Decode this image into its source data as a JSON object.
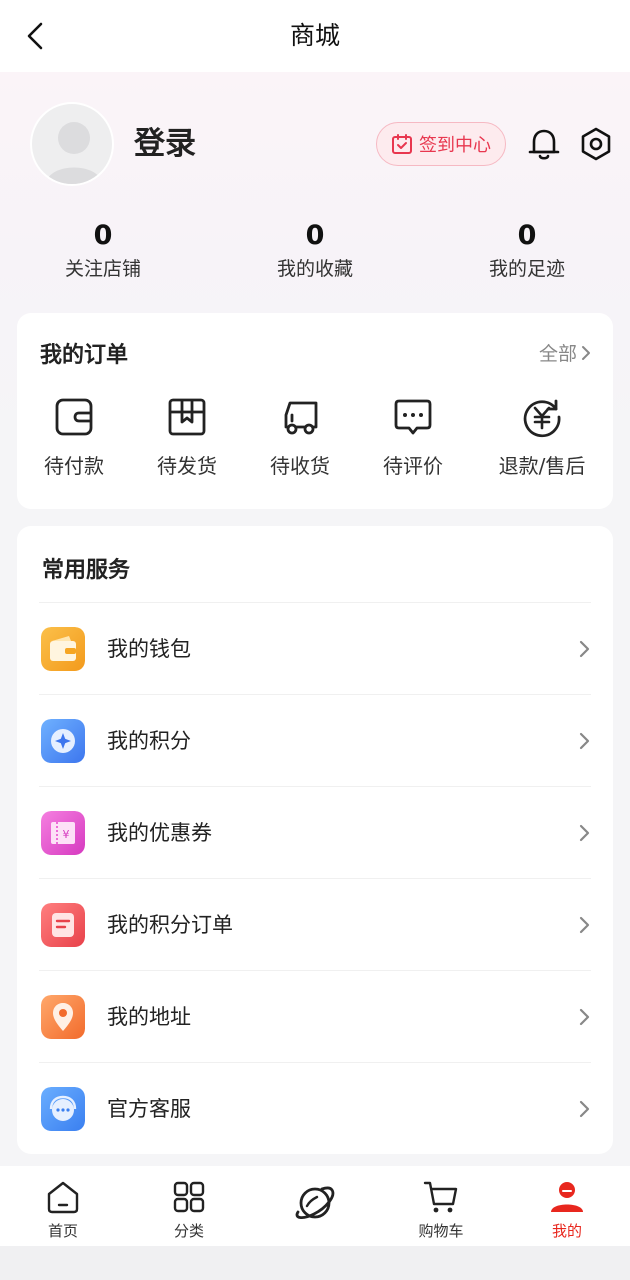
{
  "nav": {
    "title": "商城"
  },
  "profile": {
    "login_label": "登录",
    "signin_button": "签到中心"
  },
  "stats": [
    {
      "value": "0",
      "label": "关注店铺"
    },
    {
      "value": "0",
      "label": "我的收藏"
    },
    {
      "value": "0",
      "label": "我的足迹"
    }
  ],
  "orders": {
    "title": "我的订单",
    "all_label": "全部",
    "items": [
      {
        "label": "待付款",
        "icon": "wallet-icon"
      },
      {
        "label": "待发货",
        "icon": "box-icon"
      },
      {
        "label": "待收货",
        "icon": "truck-icon"
      },
      {
        "label": "待评价",
        "icon": "comment-icon"
      },
      {
        "label": "退款/售后",
        "icon": "refund-icon"
      }
    ]
  },
  "services": {
    "title": "常用服务",
    "items": [
      {
        "label": "我的钱包",
        "icon": "wallet-icon",
        "color": "#f6a623"
      },
      {
        "label": "我的积分",
        "icon": "points-icon",
        "color": "#4a8cf7"
      },
      {
        "label": "我的优惠券",
        "icon": "coupon-icon",
        "color": "#e94fd0"
      },
      {
        "label": "我的积分订单",
        "icon": "points-order-icon",
        "color": "#f0555a"
      },
      {
        "label": "我的地址",
        "icon": "location-icon",
        "color": "#f5843e"
      },
      {
        "label": "官方客服",
        "icon": "customer-service-icon",
        "color": "#3f8ff6"
      }
    ]
  },
  "tabbar": [
    {
      "label": "首页",
      "icon": "home-icon"
    },
    {
      "label": "分类",
      "icon": "category-icon"
    },
    {
      "label": "",
      "icon": "planet-icon"
    },
    {
      "label": "购物车",
      "icon": "cart-icon"
    },
    {
      "label": "我的",
      "icon": "profile-icon",
      "active": true
    }
  ],
  "colors": {
    "accent": "#e8271e",
    "signin_text": "#e8374f"
  }
}
